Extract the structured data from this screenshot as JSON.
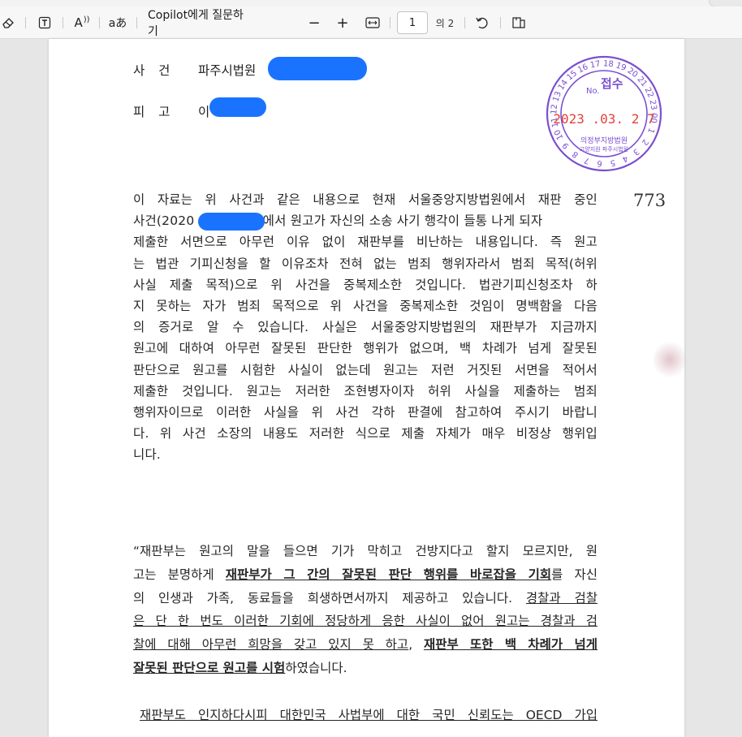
{
  "toolbar": {
    "ask_copilot_label": "Copilot에게 질문하기",
    "current_page": "1",
    "total_pages": "의 2",
    "zoom_out_symbol": "−",
    "zoom_in_symbol": "+",
    "read_aloud_symbol": "A",
    "icons": [
      "eraser-icon",
      "text-box-icon",
      "read-aloud-icon",
      "translate-icon",
      "zoom-out-icon",
      "zoom-in-icon",
      "fit-page-icon",
      "rotate-icon",
      "page-view-icon"
    ]
  },
  "document": {
    "case_label": "사 건",
    "case_value": "파주시법원",
    "defendant_label": "피 고",
    "defendant_value": "이",
    "page_number": "773",
    "stamp": {
      "numbers": [
        "15",
        "16",
        "17",
        "18",
        "19",
        "20",
        "21",
        "22",
        "23",
        "00",
        "1",
        "2",
        "3",
        "4",
        "5",
        "6",
        "7",
        "8",
        "9",
        "10",
        "11",
        "12",
        "13",
        "14"
      ],
      "title": "접수",
      "no": "No.",
      "date": "2023 .03. 2 7",
      "court_line1": "의정부지방법원",
      "court_line2": "고양지원 파주시법원",
      "color": "#7b4fd0"
    },
    "body_lines": [
      " 이 자료는 위 사건과 같은 내용으로 현재 서울중앙지방법원에서 재판 중인",
      "사건(2020",
      ")에서 원고가 자신의 소송 사기 행각이 들통 나게 되자",
      "제출한 서면으로 아무런 이유 없이 재판부를 비난하는 내용입니다. 즉 원고",
      "는 법관 기피신청을 할 이유조차 전혀 없는 범죄 행위자라서 범죄 목적(허위",
      "사실 제출 목적)으로 위 사건을 중복제소한 것입니다. 법관기피신청조차 하",
      "지 못하는 자가 범죄 목적으로 위 사건을 중복제소한 것임이 명백함을 다음",
      "의 증거로 알 수 있습니다. 사실은 서울중앙지방법원의 재판부가 지금까지",
      "원고에 대하여 아무런 잘못된 판단한 행위가 없으며, 백 차례가 넘게 잘못된",
      "판단으로 원고를 시험한 사실이 없는데 원고는 저런 거짓된 서면을 적어서",
      "제출한 것입니다. 원고는 저러한 조현병자이자 허위 사실을 제출하는 범죄",
      "행위자이므로 이러한 사실을 위 사건 각하 판결에 참고하여 주시기 바랍니",
      "다. 위 사건 소장의 내용도 저러한 식으로 제출 자체가 매우 비정상 행위입",
      "니다."
    ],
    "quote": {
      "l1": "“재판부는 원고의 말을 들으면 기가 막히고 건방지다고 할지 모르지만, 원",
      "l2a": "고는 분명하게 ",
      "l2b": "재판부가 그 간의 잘못된 판단 행위를 바로잡을 기회",
      "l2c": "를 자신",
      "l3a": "의 인생과 가족, 동료들을 희생하면서까지 제공하고 있습니다. ",
      "l3b": "경찰과 검찰",
      "l4": "은 단 한 번도 이러한 기회에 정당하게 응한 사실이 없어 원고는 경찰과 검",
      "l5a": "찰에 대해 아무런 희망을 갖고 있지 못 하고",
      "l5b": ", ",
      "l5c": "재판부 또한 백 차례가 넘게",
      "l6a": "잘못된 판단으로 원고를 시험",
      "l6b": "하였습니다.",
      "l7": "재판부도 인지하다시피 대한민국 사법부에 대한 국민 신뢰도는 OECD 가입"
    },
    "redaction_color": "#1a73ff"
  }
}
